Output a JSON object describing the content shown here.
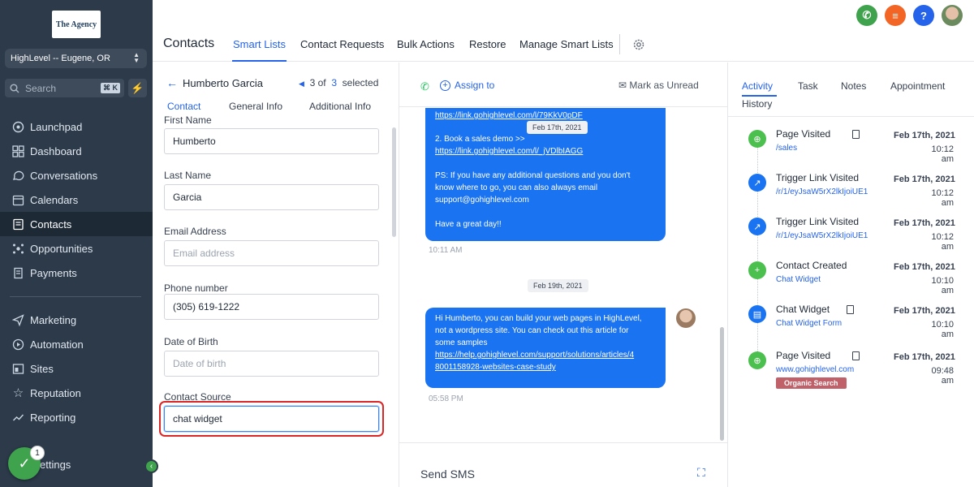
{
  "sidebar": {
    "logo_text": "The Agency",
    "location": "HighLevel -- Eugene, OR",
    "search_placeholder": "Search",
    "search_shortcut": "⌘ K",
    "nav_items": [
      {
        "label": "Launchpad",
        "icon": "launchpad-icon"
      },
      {
        "label": "Dashboard",
        "icon": "dashboard-icon"
      },
      {
        "label": "Conversations",
        "icon": "conversations-icon"
      },
      {
        "label": "Calendars",
        "icon": "calendar-icon"
      },
      {
        "label": "Contacts",
        "icon": "contacts-icon",
        "active": true
      },
      {
        "label": "Opportunities",
        "icon": "opportunities-icon"
      },
      {
        "label": "Payments",
        "icon": "payments-icon"
      }
    ],
    "nav_items_2": [
      {
        "label": "Marketing",
        "icon": "marketing-icon"
      },
      {
        "label": "Automation",
        "icon": "automation-icon"
      },
      {
        "label": "Sites",
        "icon": "sites-icon"
      },
      {
        "label": "Reputation",
        "icon": "reputation-icon"
      },
      {
        "label": "Reporting",
        "icon": "reporting-icon"
      }
    ],
    "settings_label": "Settings",
    "settings_visible": "ettings",
    "notification_count": "1"
  },
  "header": {
    "title": "Contacts",
    "tabs": [
      "Smart Lists",
      "Contact Requests",
      "Bulk Actions",
      "Restore",
      "Manage Smart Lists"
    ]
  },
  "contact": {
    "name": "Humberto Garcia",
    "pager_pos": "3",
    "pager_of": "of",
    "pager_total": "3",
    "pager_selected": "selected",
    "tabs": [
      "Contact",
      "General Info",
      "Additional Info"
    ],
    "fields": {
      "first_name_label": "First Name",
      "first_name": "Humberto",
      "last_name_label": "Last Name",
      "last_name": "Garcia",
      "email_label": "Email Address",
      "email_placeholder": "Email address",
      "phone_label": "Phone number",
      "phone": "(305) 619-1222",
      "dob_label": "Date of Birth",
      "dob_placeholder": "Date of birth",
      "source_label": "Contact Source",
      "source": "chat widget"
    }
  },
  "conversation": {
    "assign_label": "Assign to",
    "mark_unread": "Mark as Unread",
    "msg1": {
      "link1": "https://link.gohighlevel.com/l/79KkV0pDF",
      "line2": "2. Book a sales demo >>",
      "link2": "https://link.gohighlevel.com/l/_jVDlbIAGG",
      "line3": "PS: If you have any additional questions and you don't",
      "line4": "know where to go, you can also always email",
      "line5": "support@gohighlevel.com",
      "line6": "Have a great day!!",
      "time": "10:11 AM"
    },
    "date_chip_1": "Feb 17th, 2021",
    "date_chip_2": "Feb 19th, 2021",
    "msg2": {
      "line1": "Hi Humberto, you can build your web pages in HighLevel,",
      "line2": "not a wordpress site. You can check out this article for",
      "line3": "some samples",
      "link1": "https://help.gohighlevel.com/support/solutions/articles/4",
      "link2": "8001158928-websites-case-study",
      "time": "05:58 PM"
    },
    "send_sms": "Send SMS"
  },
  "activity": {
    "tabs": [
      "Activity",
      "Task",
      "Notes",
      "Appointment"
    ],
    "history_label": "History",
    "events": [
      {
        "title": "Page Visited",
        "sub": "/sales",
        "date": "Feb 17th, 2021",
        "time": "10:12 am",
        "icon": "globe-icon",
        "color": "#4cc04f",
        "clip": true
      },
      {
        "title": "Trigger Link Visited",
        "sub": "/r/1/eyJsaW5rX2lkIjoiUE1",
        "date": "Feb 17th, 2021",
        "time": "10:12 am",
        "icon": "link-icon",
        "color": "#1a73f0",
        "clip": false
      },
      {
        "title": "Trigger Link Visited",
        "sub": "/r/1/eyJsaW5rX2lkIjoiUE1",
        "date": "Feb 17th, 2021",
        "time": "10:12 am",
        "icon": "link-icon",
        "color": "#1a73f0",
        "clip": false
      },
      {
        "title": "Contact Created",
        "sub": "Chat Widget",
        "date": "Feb 17th, 2021",
        "time": "10:10 am",
        "icon": "add-user-icon",
        "color": "#4cc04f",
        "clip": false
      },
      {
        "title": "Chat Widget",
        "sub": "Chat Widget Form",
        "date": "Feb 17th, 2021",
        "time": "10:10 am",
        "icon": "form-icon",
        "color": "#1a73f0",
        "clip": true
      },
      {
        "title": "Page Visited",
        "sub": "www.gohighlevel.com",
        "date": "Feb 17th, 2021",
        "time": "09:48 am",
        "icon": "globe-icon",
        "color": "#4cc04f",
        "clip": true
      }
    ],
    "organic_badge": "Organic Search"
  },
  "colors": {
    "accent": "#2563eb",
    "sidebar": "#2c3a4a",
    "bubble": "#1a73f0",
    "highlight": "#dc2626"
  }
}
